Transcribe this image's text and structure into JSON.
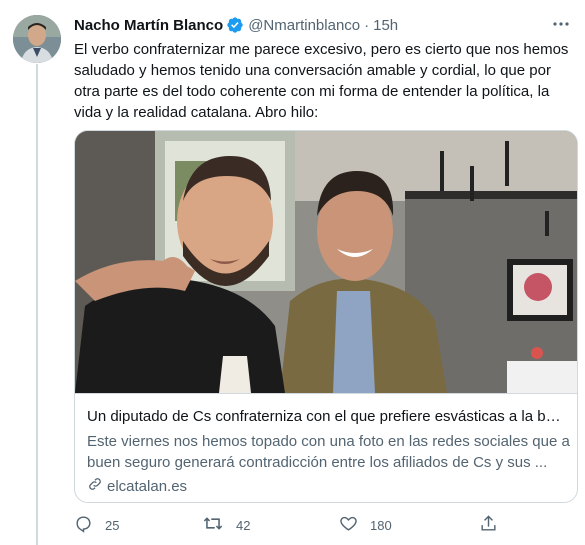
{
  "tweet": {
    "author_name": "Nacho Martín Blanco",
    "handle": "@Nmartinblanco",
    "separator": "·",
    "time": "15h",
    "text": "El verbo confraternizar me parece excesivo, pero es cierto que nos hemos saludado y hemos tenido una conversación amable y cordial, lo que por otra parte es del todo coherente con mi forma de entender la política, la vida y la realidad catalana. Abro hilo:"
  },
  "card": {
    "title": "Un diputado de Cs confraterniza con el que prefiere esvásticas a la ban...",
    "description": "Este viernes nos hemos topado con una foto en las redes sociales que a buen seguro generará contradicción entre los afiliados de Cs y sus ...",
    "domain": "elcatalan.es"
  },
  "actions": {
    "replies": "25",
    "retweets": "42",
    "likes": "180"
  },
  "colors": {
    "verified": "#1d9bf0",
    "muted_text": "#536471",
    "border": "#cfd9de"
  },
  "icons": [
    "verified-icon",
    "more-icon",
    "link-icon",
    "reply-icon",
    "retweet-icon",
    "like-icon",
    "share-icon"
  ]
}
